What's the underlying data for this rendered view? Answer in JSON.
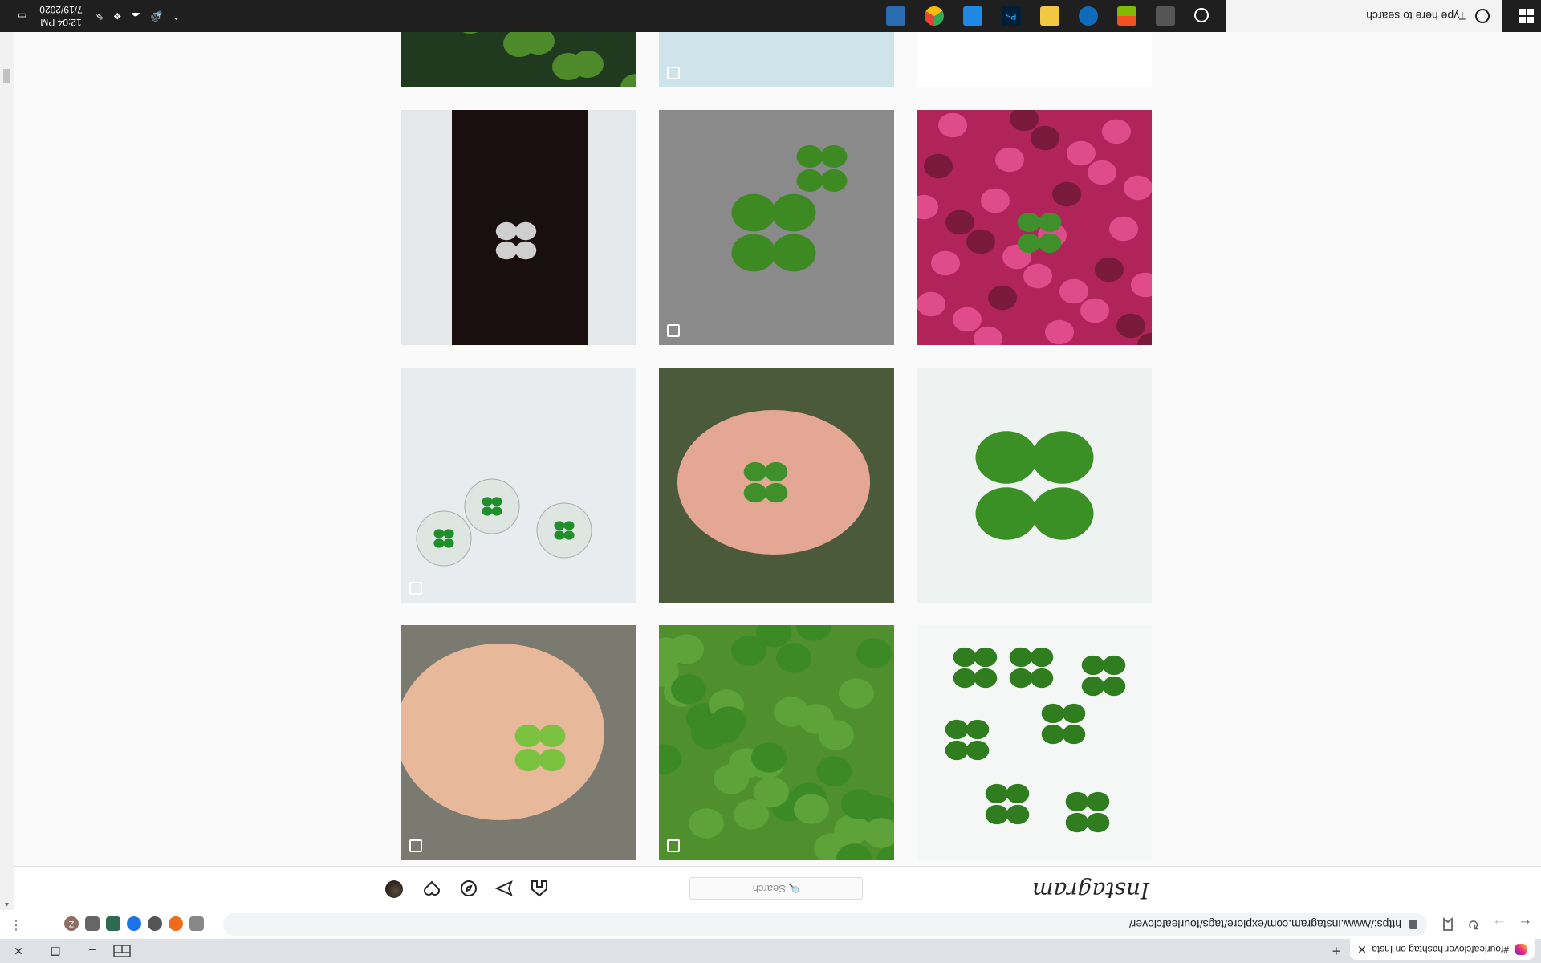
{
  "browser": {
    "tab_title": "#fourleafclover hashtag on Insta",
    "tab_close": "✕",
    "new_tab": "+",
    "url": "https://www.instagram.com/explore/tags/fourleafclover/",
    "window": {
      "minimize": "–",
      "maximize": "❐",
      "close": "✕"
    },
    "extension_avatar_letter": "Z"
  },
  "instagram": {
    "logo": "Instagram",
    "search_placeholder": "Search",
    "search_glyph": "🔍"
  },
  "grid": [
    {
      "desc": "clover",
      "type": "scatter",
      "multi": false
    },
    {
      "desc": "clover-patch",
      "type": "patch",
      "multi": true
    },
    {
      "desc": "hand-clover",
      "type": "hand",
      "multi": true
    },
    {
      "desc": "big-clover",
      "type": "big",
      "multi": false
    },
    {
      "desc": "palm-clover",
      "type": "palm",
      "multi": false
    },
    {
      "desc": "keychains",
      "type": "keychain",
      "multi": true
    },
    {
      "desc": "pink-flowers",
      "type": "pink",
      "multi": false
    },
    {
      "desc": "hand-bunch",
      "type": "bunch",
      "multi": true
    },
    {
      "desc": "bracelet",
      "type": "bracelet",
      "multi": false
    },
    {
      "desc": "top-left-partial",
      "type": "partial1",
      "multi": false
    },
    {
      "desc": "top-mid-partial",
      "type": "partial2",
      "multi": true
    },
    {
      "desc": "top-right-partial",
      "type": "partial3",
      "multi": false
    }
  ],
  "taskbar": {
    "search_placeholder": "Type here to search",
    "time": "12:04 PM",
    "date": "7/19/2020"
  },
  "colors": {
    "clover_green": "#3f8f2b",
    "bg": "#fafafa",
    "taskbar": "#1f1f1f"
  }
}
